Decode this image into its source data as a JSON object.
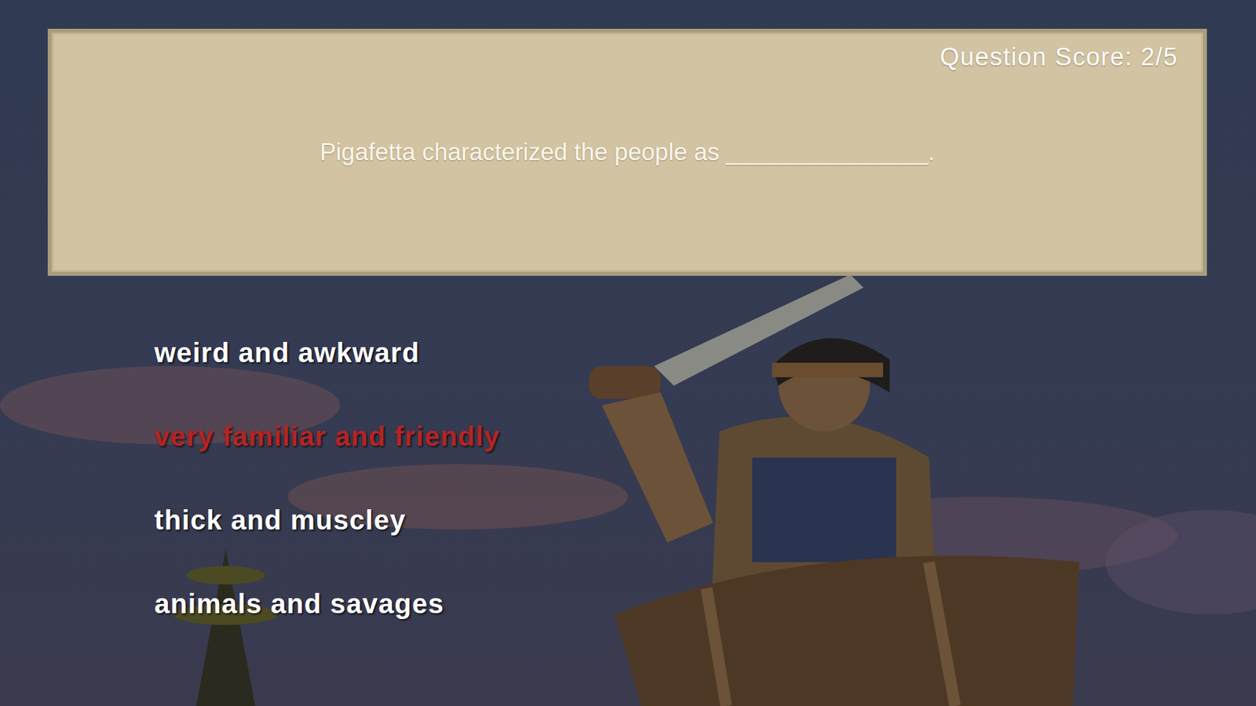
{
  "quiz": {
    "score": "Question Score: 2/5",
    "question": "Pigafetta characterized the people as _______________.",
    "answers": [
      {
        "label": "weird and awkward",
        "selected": false
      },
      {
        "label": "very familiar and friendly",
        "selected": true
      },
      {
        "label": "thick and muscley",
        "selected": false
      },
      {
        "label": "animals and savages",
        "selected": false
      }
    ]
  }
}
